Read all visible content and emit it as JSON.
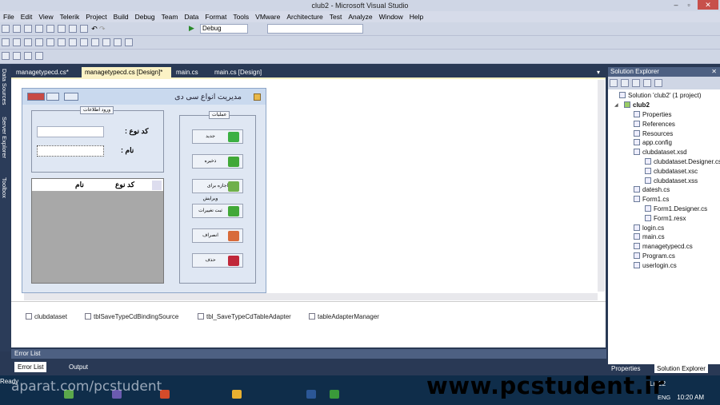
{
  "window": {
    "title": "club2 - Microsoft Visual Studio"
  },
  "menu": [
    "File",
    "Edit",
    "View",
    "Telerik",
    "Project",
    "Build",
    "Debug",
    "Team",
    "Data",
    "Format",
    "Tools",
    "VMware",
    "Architecture",
    "Test",
    "Analyze",
    "Window",
    "Help"
  ],
  "toolbar": {
    "config": "Debug",
    "config_combo_value": "",
    "glyph_undo": "↶",
    "glyph_redo": "↷",
    "glyph_play": "▶"
  },
  "left_strip": {
    "items": [
      "Data Sources",
      "Server Explorer",
      "Toolbox"
    ]
  },
  "tabs": [
    {
      "label": "managetypecd.cs*",
      "active": false
    },
    {
      "label": "managetypecd.cs [Design]*",
      "active": true
    },
    {
      "label": "main.cs",
      "active": false
    },
    {
      "label": "main.cs [Design]",
      "active": false
    }
  ],
  "form": {
    "title": "مدیریت انواع سی دی",
    "group_input": {
      "caption": "ورود اطلاعات",
      "code_label": "کد نوع :",
      "name_label": "نام :",
      "code_value": "",
      "name_value": ""
    },
    "group_ops": {
      "caption": "عملیات",
      "buttons": [
        {
          "label": "جدید",
          "color": "#3cb043"
        },
        {
          "label": "ذخیره",
          "color": "#41a837"
        },
        {
          "label": "اجازه برای ویرایش",
          "color": "#6fb04a"
        },
        {
          "label": "ثبت تغییرات",
          "color": "#41a837"
        },
        {
          "label": "انصراف",
          "color": "#d86b3a"
        },
        {
          "label": "حذف",
          "color": "#c0283a"
        }
      ]
    },
    "grid": {
      "columns": [
        "کد نوع",
        "نام"
      ]
    }
  },
  "tray": [
    "clubdataset",
    "tblSaveTypeCdBindingSource",
    "tbl_SaveTypeCdTableAdapter",
    "tableAdapterManager"
  ],
  "solution_explorer": {
    "title": "Solution Explorer",
    "solution": "Solution 'club2' (1 project)",
    "project": "club2",
    "items": [
      {
        "label": "Properties",
        "indent": 2
      },
      {
        "label": "References",
        "indent": 2
      },
      {
        "label": "Resources",
        "indent": 2
      },
      {
        "label": "app.config",
        "indent": 2
      },
      {
        "label": "clubdataset.xsd",
        "indent": 2
      },
      {
        "label": "clubdataset.Designer.cs",
        "indent": 3
      },
      {
        "label": "clubdataset.xsc",
        "indent": 3
      },
      {
        "label": "clubdataset.xss",
        "indent": 3
      },
      {
        "label": "datesh.cs",
        "indent": 2
      },
      {
        "label": "Form1.cs",
        "indent": 2
      },
      {
        "label": "Form1.Designer.cs",
        "indent": 3
      },
      {
        "label": "Form1.resx",
        "indent": 3
      },
      {
        "label": "login.cs",
        "indent": 2
      },
      {
        "label": "main.cs",
        "indent": 2
      },
      {
        "label": "managetypecd.cs",
        "indent": 2
      },
      {
        "label": "Program.cs",
        "indent": 2
      },
      {
        "label": "userlogin.cs",
        "indent": 2
      }
    ],
    "bottom_tabs": [
      "Properties",
      "Solution Explorer"
    ]
  },
  "error_list": {
    "title": "Error List",
    "tabs": [
      "Error List",
      "Output"
    ]
  },
  "status": {
    "text": "Ready",
    "line": "Ln 22"
  },
  "taskbar": {
    "lang": "ENG",
    "time": "10:20 AM"
  },
  "watermark": {
    "main": "www.pcstudent.ir",
    "secondary": "aparat.com/pcstudent"
  }
}
